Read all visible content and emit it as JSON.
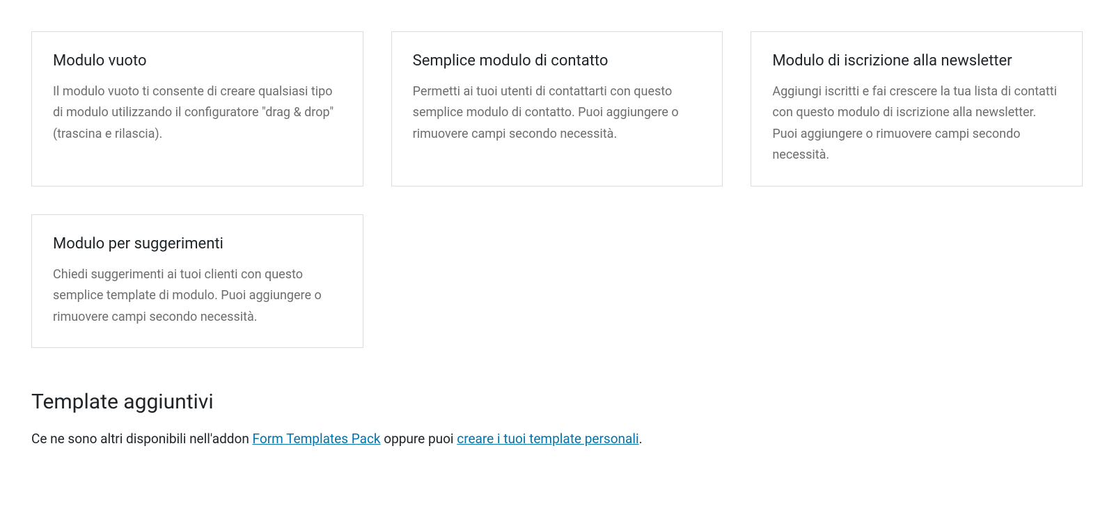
{
  "templates": [
    {
      "title": "Modulo vuoto",
      "description": "Il modulo vuoto ti consente di creare qualsiasi tipo di modulo utilizzando il configuratore \"drag & drop\" (trascina e rilascia)."
    },
    {
      "title": "Semplice modulo di contatto",
      "description": "Permetti ai tuoi utenti di contattarti con questo semplice modulo di contatto. Puoi aggiungere o rimuovere campi secondo necessità."
    },
    {
      "title": "Modulo di iscrizione alla newsletter",
      "description": "Aggiungi iscritti e fai crescere la tua lista di contatti con questo modulo di iscrizione alla newsletter. Puoi aggiungere o rimuovere campi secondo necessità."
    },
    {
      "title": "Modulo per suggerimenti",
      "description": "Chiedi suggerimenti ai tuoi clienti con questo semplice template di modulo. Puoi aggiungere o rimuovere campi secondo necessità."
    }
  ],
  "additionalSection": {
    "heading": "Template aggiuntivi",
    "textBefore": "Ce ne sono altri disponibili nell'addon ",
    "link1": "Form Templates Pack",
    "textMiddle": " oppure puoi ",
    "link2": "creare i tuoi template personali",
    "textAfter": "."
  }
}
